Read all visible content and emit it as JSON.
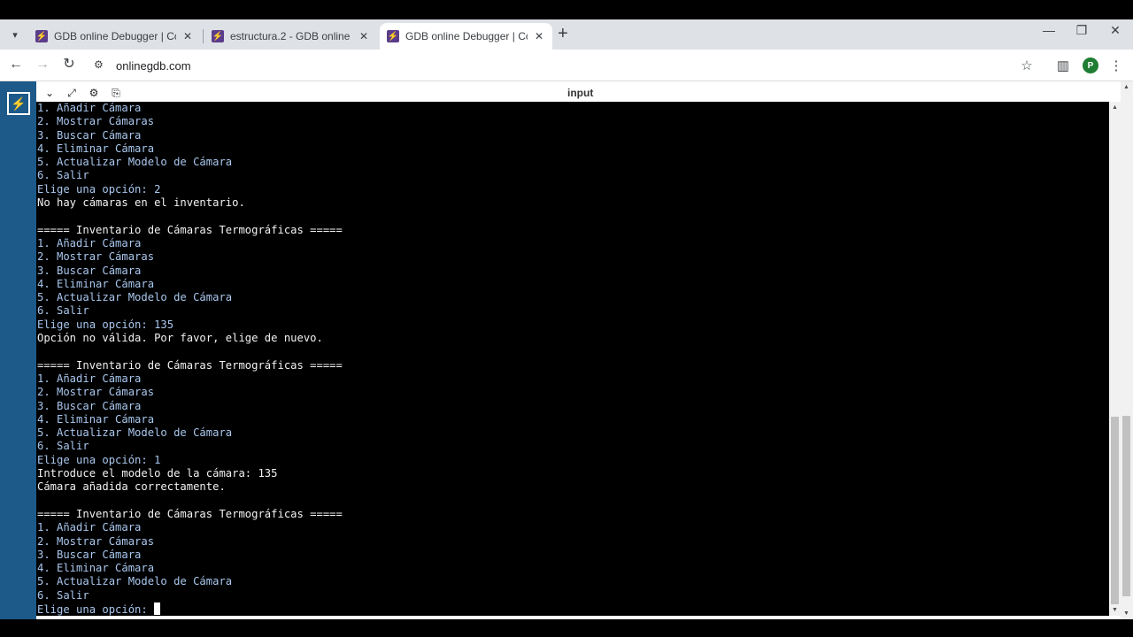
{
  "browser": {
    "tabs": [
      {
        "title": "GDB online Debugger | Compiler",
        "active": false
      },
      {
        "title": "estructura.2 - GDB online Debugger",
        "active": false
      },
      {
        "title": "GDB online Debugger | Compiler",
        "active": true
      }
    ],
    "url": "onlinegdb.com",
    "profile_initial": "P"
  },
  "io_panel": {
    "label": "input"
  },
  "terminal": {
    "lines": [
      {
        "text": "1. Añadir Cámara",
        "kind": "menu"
      },
      {
        "text": "2. Mostrar Cámaras",
        "kind": "menu"
      },
      {
        "text": "3. Buscar Cámara",
        "kind": "menu"
      },
      {
        "text": "4. Eliminar Cámara",
        "kind": "menu"
      },
      {
        "text": "5. Actualizar Modelo de Cámara",
        "kind": "menu"
      },
      {
        "text": "6. Salir",
        "kind": "menu"
      },
      {
        "text": "Elige una opción: 2",
        "kind": "menu"
      },
      {
        "text": "No hay cámaras en el inventario.",
        "kind": "out"
      },
      {
        "text": "",
        "kind": "out"
      },
      {
        "text": "===== Inventario de Cámaras Termográficas =====",
        "kind": "out"
      },
      {
        "text": "1. Añadir Cámara",
        "kind": "menu"
      },
      {
        "text": "2. Mostrar Cámaras",
        "kind": "menu"
      },
      {
        "text": "3. Buscar Cámara",
        "kind": "menu"
      },
      {
        "text": "4. Eliminar Cámara",
        "kind": "menu"
      },
      {
        "text": "5. Actualizar Modelo de Cámara",
        "kind": "menu"
      },
      {
        "text": "6. Salir",
        "kind": "menu"
      },
      {
        "text": "Elige una opción: 135",
        "kind": "menu"
      },
      {
        "text": "Opción no válida. Por favor, elige de nuevo.",
        "kind": "out"
      },
      {
        "text": "",
        "kind": "out"
      },
      {
        "text": "===== Inventario de Cámaras Termográficas =====",
        "kind": "out"
      },
      {
        "text": "1. Añadir Cámara",
        "kind": "menu"
      },
      {
        "text": "2. Mostrar Cámaras",
        "kind": "menu"
      },
      {
        "text": "3. Buscar Cámara",
        "kind": "menu"
      },
      {
        "text": "4. Eliminar Cámara",
        "kind": "menu"
      },
      {
        "text": "5. Actualizar Modelo de Cámara",
        "kind": "menu"
      },
      {
        "text": "6. Salir",
        "kind": "menu"
      },
      {
        "text": "Elige una opción: 1",
        "kind": "menu"
      },
      {
        "text": "Introduce el modelo de la cámara: 135",
        "kind": "out"
      },
      {
        "text": "Cámara añadida correctamente.",
        "kind": "out"
      },
      {
        "text": "",
        "kind": "out"
      },
      {
        "text": "===== Inventario de Cámaras Termográficas =====",
        "kind": "out"
      },
      {
        "text": "1. Añadir Cámara",
        "kind": "menu"
      },
      {
        "text": "2. Mostrar Cámaras",
        "kind": "menu"
      },
      {
        "text": "3. Buscar Cámara",
        "kind": "menu"
      },
      {
        "text": "4. Eliminar Cámara",
        "kind": "menu"
      },
      {
        "text": "5. Actualizar Modelo de Cámara",
        "kind": "menu"
      },
      {
        "text": "6. Salir",
        "kind": "menu"
      }
    ],
    "prompt": "Elige una opción: "
  }
}
